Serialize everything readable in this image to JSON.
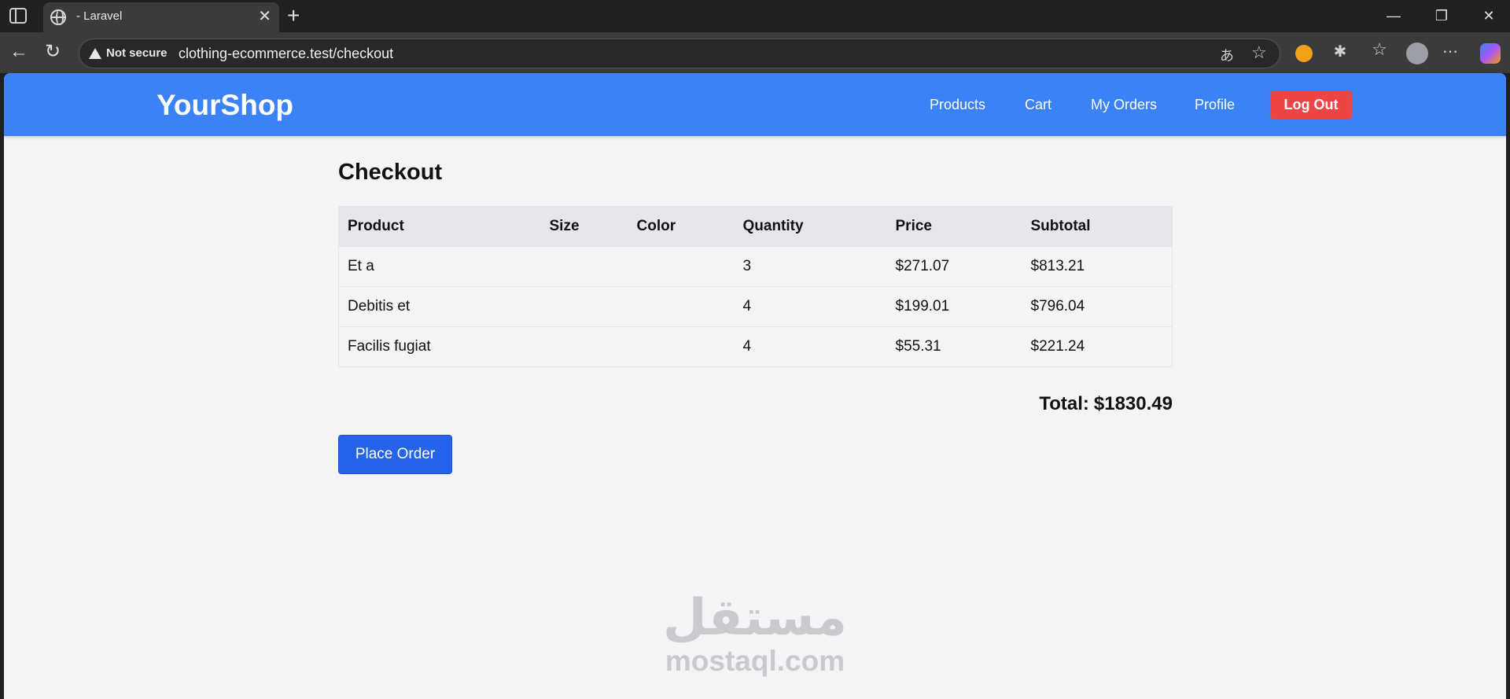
{
  "browser": {
    "tab_title": "- Laravel",
    "tab_close": "✕",
    "new_tab": "+",
    "security_label": "Not secure",
    "url": "clothing-ecommerce.test/checkout",
    "window_controls": {
      "minimize": "—",
      "restore": "❐",
      "close": "✕"
    },
    "nav": {
      "back": "←",
      "reload": "↻"
    },
    "omnibox_icons": {
      "translate": "あ",
      "favorite": "☆"
    },
    "extension_icons": {
      "extensions": "✱",
      "favorites": "☆",
      "more": "⋯"
    }
  },
  "header": {
    "brand": "YourShop",
    "nav": [
      "Products",
      "Cart",
      "My Orders",
      "Profile"
    ],
    "logout": "Log Out",
    "color": "#3b82f6"
  },
  "checkout": {
    "title": "Checkout",
    "columns": [
      "Product",
      "Size",
      "Color",
      "Quantity",
      "Price",
      "Subtotal"
    ],
    "rows": [
      {
        "product": "Et a",
        "size": "",
        "color": "",
        "quantity": "3",
        "price": "$271.07",
        "subtotal": "$813.21"
      },
      {
        "product": "Debitis et",
        "size": "",
        "color": "",
        "quantity": "4",
        "price": "$199.01",
        "subtotal": "$796.04"
      },
      {
        "product": "Facilis fugiat",
        "size": "",
        "color": "",
        "quantity": "4",
        "price": "$55.31",
        "subtotal": "$221.24"
      }
    ],
    "total_label": "Total:",
    "total_value": "$1830.49",
    "place_order": "Place Order"
  },
  "watermark": {
    "arabic": "مستقل",
    "latin": "mostaql.com"
  }
}
